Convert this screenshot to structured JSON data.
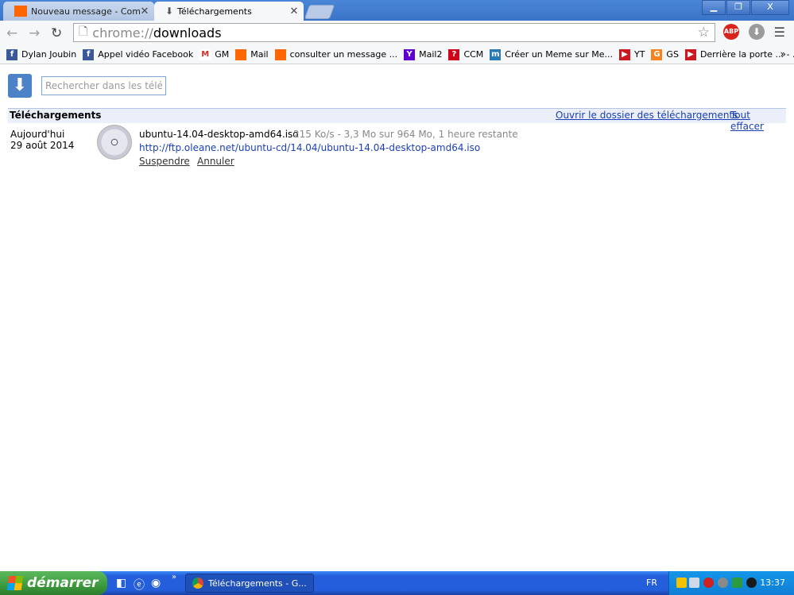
{
  "browser": {
    "tabs": [
      {
        "title": "Nouveau message - Commun",
        "active": false
      },
      {
        "title": "Téléchargements",
        "active": true
      }
    ],
    "window_controls": {
      "minimize": "▁",
      "restore": "❐",
      "close": "X"
    },
    "url_scheme": "chrome://",
    "url_path": "downloads",
    "extensions": {
      "abp_label": "ABP"
    },
    "bookmarks": [
      {
        "label": "Dylan Joubin",
        "icon": "facebook-icon",
        "color": "#3b5998",
        "glyph": "f"
      },
      {
        "label": "Appel vidéo Facebook",
        "icon": "facebook-icon",
        "color": "#3b5998",
        "glyph": "f"
      },
      {
        "label": "GM",
        "icon": "gmail-icon",
        "color": "#ffffff",
        "glyph": "M"
      },
      {
        "label": "Mail",
        "icon": "orange-icon",
        "color": "#ff6600",
        "glyph": ""
      },
      {
        "label": "consulter un message ...",
        "icon": "orange-icon",
        "color": "#ff6600",
        "glyph": ""
      },
      {
        "label": "Mail2",
        "icon": "yahoo-icon",
        "color": "#5f01d1",
        "glyph": "Y"
      },
      {
        "label": "CCM",
        "icon": "ccm-icon",
        "color": "#d0021b",
        "glyph": "?"
      },
      {
        "label": "Créer un Meme sur Me...",
        "icon": "meme-icon",
        "color": "#2a7ab8",
        "glyph": "m"
      },
      {
        "label": "YT",
        "icon": "youtube-icon",
        "color": "#cc181e",
        "glyph": "▶"
      },
      {
        "label": "GS",
        "icon": "gs-icon",
        "color": "#f58220",
        "glyph": "G"
      },
      {
        "label": "Derrière la porte ... - ...",
        "icon": "youtube-icon",
        "color": "#cc181e",
        "glyph": "▶"
      }
    ],
    "bookmarks_overflow": "»"
  },
  "downloads": {
    "search_placeholder": "Rechercher dans les téléc",
    "section_title": "Téléchargements",
    "open_folder_label": "Ouvrir le dossier des téléchargements",
    "clear_all_label": "Tout effacer",
    "items": [
      {
        "date_label": "Aujourd'hui",
        "date": "29 août 2014",
        "file_name": "ubuntu-14.04-desktop-amd64.iso",
        "progress_text": "215 Ko/s - 3,3 Mo sur 964 Mo, 1 heure restante",
        "url": "http://ftp.oleane.net/ubuntu-cd/14.04/ubuntu-14.04-desktop-amd64.iso",
        "actions": {
          "suspend": "Suspendre",
          "cancel": "Annuler"
        }
      }
    ]
  },
  "taskbar": {
    "start_label": "démarrer",
    "quicklaunch_more": "»",
    "task_label": "Téléchargements - G...",
    "language": "FR",
    "clock": "13:37"
  },
  "colors": {
    "link": "#1a3fb8",
    "accent": "#4b82c8",
    "taskbar": "#245edb",
    "start": "#3c9a3c"
  }
}
